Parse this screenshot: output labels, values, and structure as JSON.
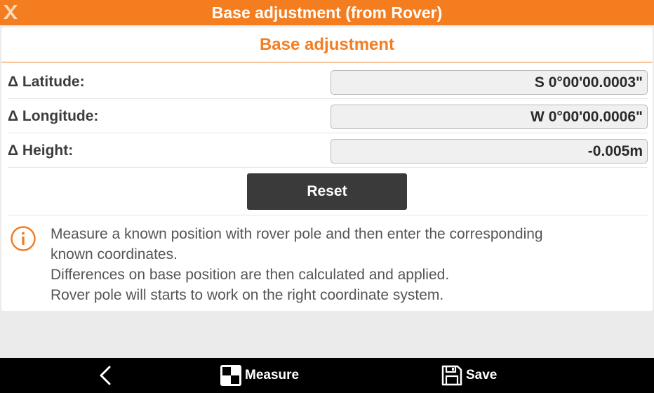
{
  "titlebar": {
    "title": "Base adjustment (from Rover)",
    "logo_icon": "app-logo",
    "accent": "#f47d20"
  },
  "panel": {
    "title": "Base adjustment",
    "fields": [
      {
        "label": "Δ Latitude:",
        "value": "S 0°00'00.0003\""
      },
      {
        "label": "Δ Longitude:",
        "value": "W 0°00'00.0006\""
      },
      {
        "label": "Δ Height:",
        "value": "-0.005m"
      }
    ],
    "reset_label": "Reset"
  },
  "info": {
    "icon": "info-icon",
    "lines": [
      "Measure a known position with rover pole and then enter the corresponding",
      "known coordinates.",
      "Differences on base position are then calculated and applied.",
      "Rover pole will starts to work on the right coordinate system."
    ]
  },
  "bottombar": {
    "back_icon": "chevron-left-icon",
    "measure_label": "Measure",
    "measure_icon": "checker-target-icon",
    "save_label": "Save",
    "save_icon": "floppy-disk-icon"
  }
}
